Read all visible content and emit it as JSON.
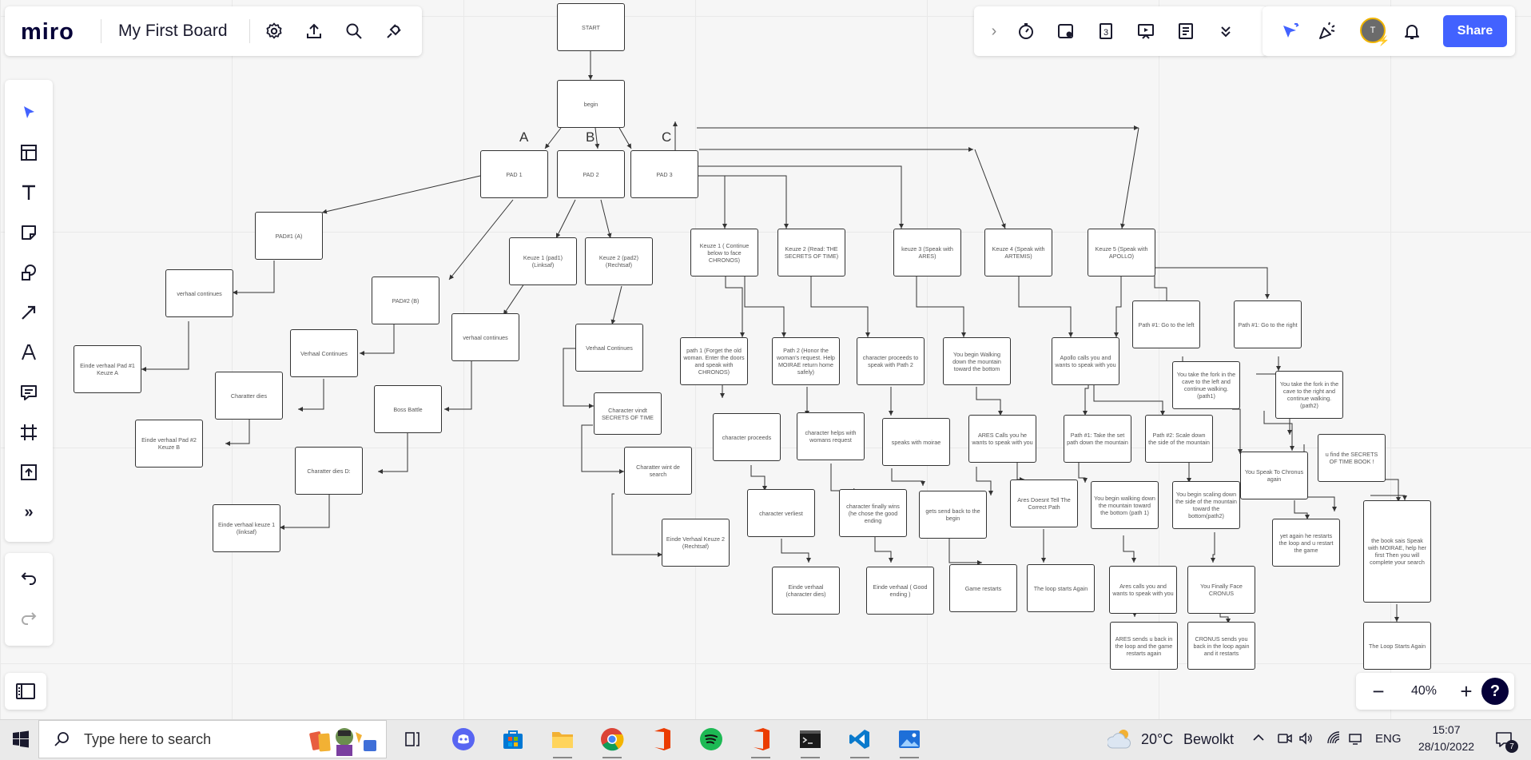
{
  "app": {
    "logo": "miro",
    "board_title": "My First Board",
    "share_label": "Share",
    "avatar_initial": "T",
    "badge_count": "3"
  },
  "zoom": {
    "value": "40%",
    "minus": "−",
    "plus": "+",
    "help": "?"
  },
  "flow": {
    "labels": {
      "a": "A",
      "b": "B",
      "c": "C"
    },
    "nodes": {
      "start": "START",
      "begin": "begin",
      "pad1": "PAD 1",
      "pad2": "PAD 2",
      "pad3": "PAD 3",
      "pad1a": "PAD#1 (A)",
      "pad2b": "PAD#2 (B)",
      "verhaal_continues_a": "verhaal continues",
      "einde_pad1_keuze_a": "Einde verhaal Pad #1 Keuze A",
      "verhaal_continues_b": "Verhaal Continues",
      "charatter_dies": "Charatter dies",
      "einde_pad2_keuze_b": "Einde verhaal Pad #2 Keuze B",
      "keuze1_pad1": "Keuze 1 (pad1) (Linksaf)",
      "keuze2_pad2": "Keuze 2 (pad2) (Rechtsaf)",
      "verhaal_continues_c": "verhaal continues",
      "boss_battle": "Boss Battle",
      "charatter_dies_d": "Charatter dies D:",
      "einde_keuze1_linksaf": "Einde verhaal keuze 1 (linksaf)",
      "verhaal_continues_d": "Verhaal Continues",
      "character_vindt": "Character vindt SECRETS OF TIME",
      "charatter_wint": "Charatter wint de search",
      "einde_keuze2_rechtsaf": "Einde Verhaal Keuze 2 (Rechtsaf)",
      "keuze1_chronos": "Keuze 1 ( Continue below to face CHRONOS)",
      "keuze2_read": "Keuze 2 (Read: THE SECRETS OF TIME)",
      "keuze3_ares": "keuze 3 (Speak with ARES)",
      "keuze4_artemis": "Keuze 4 (Speak with ARTEMIS)",
      "keuze5_apollo": "Keuze 5 (Speak with APOLLO)",
      "path1_forget": "path 1 (Forget the old woman. Enter the doors and speak with CHRONOS)",
      "path2_honor": "Path 2 (Honor the woman's request. Help MOIRAE return home safely)",
      "char_proceeds_path2": "character proceeds to speak with Path 2",
      "begin_walking_bottom": "You begin Walking down the mountain toward the bottom",
      "apollo_calls": "Apollo calls you and wants to speak with you",
      "path1_left": "Path #1: Go to the left",
      "path1_right": "Path #1: Go to the right",
      "character_proceeds": "character proceeds",
      "character_helps": "character helps with womans request",
      "speaks_moirae": "speaks with moirae",
      "ares_calls": "ARES Calls you he wants to speak with you",
      "take_set_path": "Path #1: Take the set path down the mountain",
      "scale_down": "Path #2: Scale down the side of the mountain",
      "fork_left": "You take the fork in the cave to the left and continue walking. (path1)",
      "fork_right": "You take the fork in the cave to the right and continue walking.(path2)",
      "character_verliest": "character verliest",
      "character_finally_wins": "character finally wins (he chose the good ending",
      "gets_send_back": "gets send back to the begin",
      "ares_doesnt_tell": "Ares Doesnt Tell The Correct Path",
      "begin_walking_path1": "You begin walking down the mountain toward the bottom (path 1)",
      "begin_scaling": "You begin scaling down the side of the mountain toward the bottom(path2)",
      "speak_chronus": "You Speak To Chronus again",
      "find_secrets_book": "u find the SECRETS OF TIME BOOK !",
      "einde_dies": "Einde verhaal (character dies)",
      "einde_good": "Einde verhaal ( Good ending )",
      "game_restarts": "Game restarts",
      "loop_starts_again": "The loop starts Again",
      "ares_calls_2": "Ares calls you and wants to speak with you",
      "finally_face_cronus": "You Finally Face CRONUS",
      "yet_again_restarts": "yet again he restarts the loop and u restart the game",
      "book_says": "the book sais Speak with MOIRAE, help her first Then you will complete your search",
      "ares_sends_back": "ARES sends u back in the loop and the game restarts again",
      "cronus_sends_back": "CRONUS sends you back in the loop again and it restarts",
      "loop_starts_again_2": "The Loop Starts Again"
    }
  },
  "taskbar": {
    "search_placeholder": "Type here to search",
    "weather_temp": "20°C",
    "weather_text": "Bewolkt",
    "language": "ENG",
    "time": "15:07",
    "date": "28/10/2022",
    "notification_count": "7"
  }
}
